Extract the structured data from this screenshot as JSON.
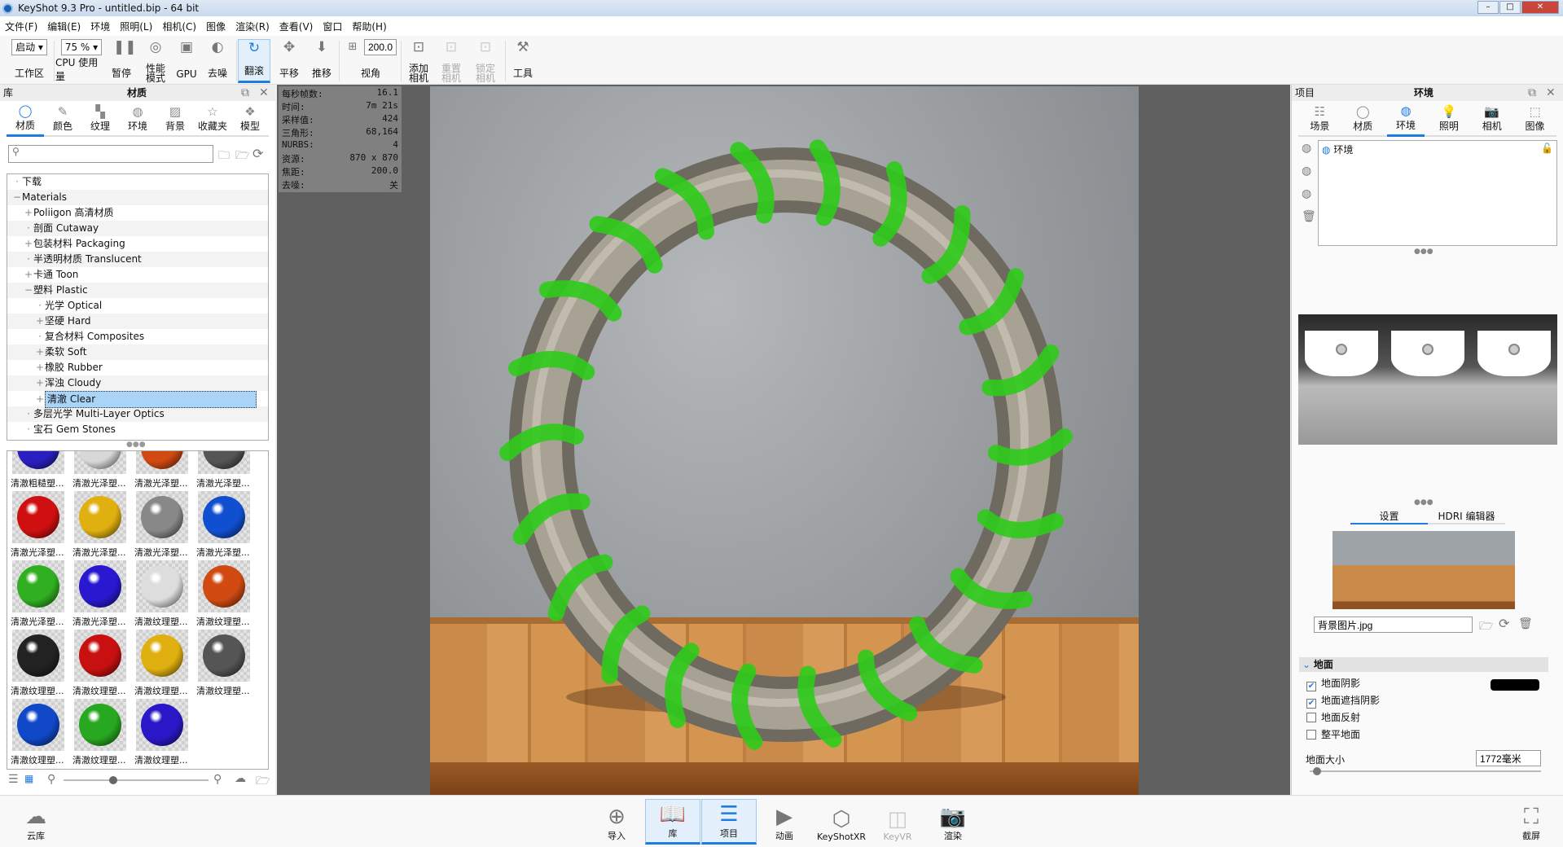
{
  "window": {
    "title": "KeyShot 9.3 Pro  - untitled.bip  - 64 bit"
  },
  "menu": [
    "文件(F)",
    "编辑(E)",
    "环境",
    "照明(L)",
    "相机(C)",
    "图像",
    "渲染(R)",
    "查看(V)",
    "窗口",
    "帮助(H)"
  ],
  "toolbar": {
    "workspace_value": "启动",
    "workspace_label": "工作区",
    "cpu_value": "75 %",
    "cpu_label": "CPU 使用量",
    "pause": "暂停",
    "perf1": "性能",
    "perf2": "模式",
    "gpu": "GPU",
    "denoise": "去噪",
    "tumble": "翻滚",
    "pan": "平移",
    "dolly": "推移",
    "fov_value": "200.0",
    "fov_label": "视角",
    "add_cam1": "添加",
    "add_cam2": "相机",
    "reset_cam1": "重置",
    "reset_cam2": "相机",
    "lock_cam1": "锁定",
    "lock_cam2": "相机",
    "tools": "工具"
  },
  "library": {
    "title_left": "库",
    "title": "材质",
    "tabs": [
      "材质",
      "颜色",
      "纹理",
      "环境",
      "背景",
      "收藏夹",
      "模型"
    ],
    "search_placeholder": "",
    "tree": [
      {
        "label": "下载",
        "level": 0,
        "pm": ""
      },
      {
        "label": "Materials",
        "level": 0,
        "pm": "−"
      },
      {
        "label": "Poliigon 高清材质",
        "level": 1,
        "pm": "+"
      },
      {
        "label": "剖面 Cutaway",
        "level": 1,
        "pm": ""
      },
      {
        "label": "包装材料 Packaging",
        "level": 1,
        "pm": "+"
      },
      {
        "label": "半透明材质 Translucent",
        "level": 1,
        "pm": ""
      },
      {
        "label": "卡通 Toon",
        "level": 1,
        "pm": "+"
      },
      {
        "label": "塑料 Plastic",
        "level": 1,
        "pm": "−"
      },
      {
        "label": "光学 Optical",
        "level": 2,
        "pm": ""
      },
      {
        "label": "坚硬 Hard",
        "level": 2,
        "pm": "+"
      },
      {
        "label": "复合材料 Composites",
        "level": 2,
        "pm": ""
      },
      {
        "label": "柔软 Soft",
        "level": 2,
        "pm": "+"
      },
      {
        "label": "橡胶 Rubber",
        "level": 2,
        "pm": "+"
      },
      {
        "label": "浑浊 Cloudy",
        "level": 2,
        "pm": "+"
      },
      {
        "label": "清澈 Clear",
        "level": 2,
        "pm": "+",
        "selected": true
      },
      {
        "label": "多层光学 Multi-Layer Optics",
        "level": 1,
        "pm": ""
      },
      {
        "label": "宝石 Gem Stones",
        "level": 1,
        "pm": ""
      }
    ],
    "thumbnails": [
      {
        "label": "清澈粗糙塑...",
        "color": "#2a1fc0"
      },
      {
        "label": "清澈光泽塑...",
        "color": "#d8d8d8"
      },
      {
        "label": "清澈光泽塑...",
        "color": "#d04a12"
      },
      {
        "label": "清澈光泽塑...",
        "color": "#555555"
      },
      {
        "label": "清澈光泽塑...",
        "color": "#d01010"
      },
      {
        "label": "清澈光泽塑...",
        "color": "#e0b010"
      },
      {
        "label": "清澈光泽塑...",
        "color": "#888888"
      },
      {
        "label": "清澈光泽塑...",
        "color": "#1050d0"
      },
      {
        "label": "清澈光泽塑...",
        "color": "#30b020"
      },
      {
        "label": "清澈光泽塑...",
        "color": "#2a18d0"
      },
      {
        "label": "清澈纹理塑...",
        "color": "#dddddd"
      },
      {
        "label": "清澈纹理塑...",
        "color": "#d04a12"
      },
      {
        "label": "清澈纹理塑...",
        "color": "#222222"
      },
      {
        "label": "清澈纹理塑...",
        "color": "#c81010"
      },
      {
        "label": "清澈纹理塑...",
        "color": "#e0b010"
      },
      {
        "label": "清澈纹理塑...",
        "color": "#555555"
      },
      {
        "label": "清澈纹理塑...",
        "color": "#1048c8"
      },
      {
        "label": "清澈纹理塑...",
        "color": "#28a820"
      },
      {
        "label": "清澈纹理塑...",
        "color": "#2a18c8"
      }
    ]
  },
  "stats": [
    {
      "k": "每秒帧数:",
      "v": "16.1"
    },
    {
      "k": "时间:",
      "v": "7m 21s"
    },
    {
      "k": "采样值:",
      "v": "424"
    },
    {
      "k": "三角形:",
      "v": "68,164"
    },
    {
      "k": "NURBS:",
      "v": "4"
    },
    {
      "k": "资源:",
      "v": "870 x 870"
    },
    {
      "k": "焦距:",
      "v": "200.0"
    },
    {
      "k": "去噪:",
      "v": "关"
    }
  ],
  "project": {
    "title_left": "项目",
    "title": "环境",
    "tabs": [
      "场景",
      "材质",
      "环境",
      "照明",
      "相机",
      "图像"
    ],
    "env_item": "环境",
    "subtabs": [
      "设置",
      "HDRI 编辑器"
    ],
    "bg_file": "背景图片.jpg",
    "ground_section": "地面",
    "checks": [
      {
        "label": "地面阴影",
        "checked": true
      },
      {
        "label": "地面遮挡阴影",
        "checked": true
      },
      {
        "label": "地面反射",
        "checked": false
      },
      {
        "label": "整平地面",
        "checked": false
      }
    ],
    "shadow_color": "#000000",
    "ground_size_label": "地面大小",
    "ground_size_value": "1772毫米"
  },
  "bottom": {
    "cloud": "云库",
    "buttons": [
      "导入",
      "库",
      "项目",
      "动画",
      "KeyShotXR",
      "KeyVR",
      "渲染"
    ],
    "screenshot": "截屏"
  },
  "colors": {
    "accent": "#1e7be0",
    "selection": "#a9d3f7"
  }
}
